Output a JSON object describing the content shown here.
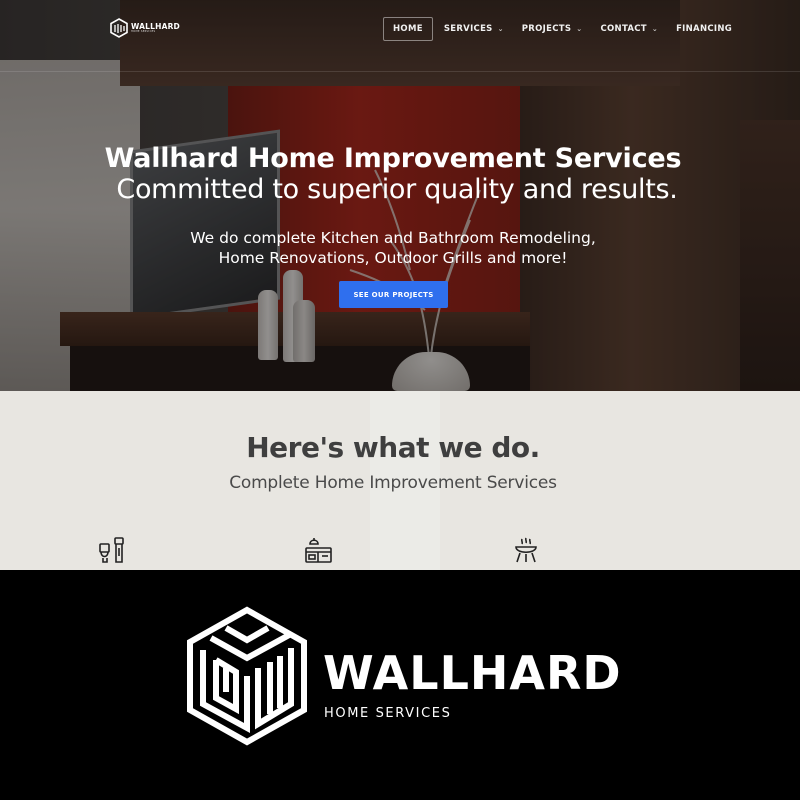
{
  "nav": {
    "logo_text": "WALLHARD",
    "logo_subtext": "HOME SERVICES",
    "items": [
      {
        "label": "HOME",
        "has_dropdown": false,
        "active": true
      },
      {
        "label": "SERVICES",
        "has_dropdown": true,
        "active": false
      },
      {
        "label": "PROJECTS",
        "has_dropdown": true,
        "active": false
      },
      {
        "label": "CONTACT",
        "has_dropdown": true,
        "active": false
      },
      {
        "label": "FINANCING",
        "has_dropdown": false,
        "active": false
      }
    ]
  },
  "hero": {
    "title": "Wallhard Home Improvement Services",
    "subtitle": "Committed to superior quality and results.",
    "description_line1": "We do complete Kitchen and Bathroom Remodeling,",
    "description_line2": "Home Renovations, Outdoor Grills and more!",
    "cta_label": "SEE OUR PROJECTS"
  },
  "services": {
    "title": "Here's what we do.",
    "subtitle": "Complete Home Improvement Services",
    "icons": [
      "bathroom-fixtures-icon",
      "kitchen-icon",
      "grill-icon"
    ]
  },
  "brand": {
    "name": "WALLHARD",
    "tagline": "HOME SERVICES"
  },
  "colors": {
    "accent": "#2f6fee",
    "brand_bg": "#000000",
    "text_light": "#ffffff"
  }
}
